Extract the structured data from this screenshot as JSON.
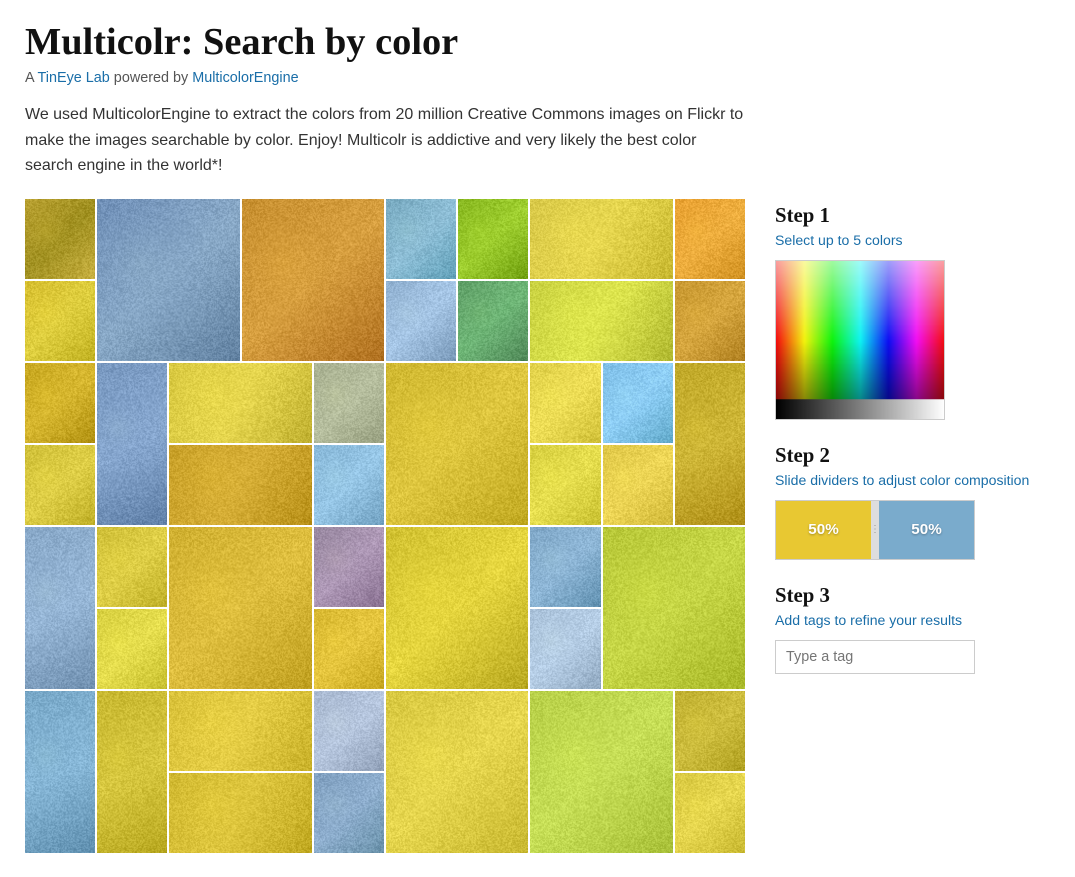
{
  "page": {
    "title": "Multicolr: Search by color",
    "subtitle_prefix": "A ",
    "subtitle_lab": "TinEye Lab",
    "subtitle_mid": " powered by ",
    "subtitle_engine": "MulticolorEngine",
    "description": "We used MulticolorEngine to extract the colors from 20 million Creative Commons images on Flickr to make the images searchable by color. Enjoy! Multicolr is addictive and very likely the best color search engine in the world*!"
  },
  "steps": {
    "step1": {
      "title": "Step 1",
      "desc": "Select up to 5 colors"
    },
    "step2": {
      "title": "Step 2",
      "desc": "Slide dividers to adjust color composition",
      "bar1_label": "50%",
      "bar2_label": "50%",
      "bar1_color": "#e8c832",
      "bar2_color": "#7aabcc"
    },
    "step3": {
      "title": "Step 3",
      "desc": "Add tags to refine your results",
      "tag_placeholder": "Type a tag"
    }
  },
  "grid": {
    "cells": [
      {
        "col": 1,
        "row": 1,
        "span_col": 1,
        "span_row": 1,
        "color": "#c8b040"
      },
      {
        "col": 2,
        "row": 1,
        "span_col": 2,
        "span_row": 2,
        "color": "#87aacc"
      },
      {
        "col": 4,
        "row": 1,
        "span_col": 2,
        "span_row": 2,
        "color": "#d4a030"
      },
      {
        "col": 6,
        "row": 1,
        "span_col": 2,
        "span_row": 1,
        "color": "#90b8d0"
      },
      {
        "col": 8,
        "row": 1,
        "span_col": 1,
        "span_row": 2,
        "color": "#80c8e8"
      },
      {
        "col": 9,
        "row": 1,
        "span_col": 2,
        "span_row": 1,
        "color": "#e8d060"
      }
    ]
  }
}
